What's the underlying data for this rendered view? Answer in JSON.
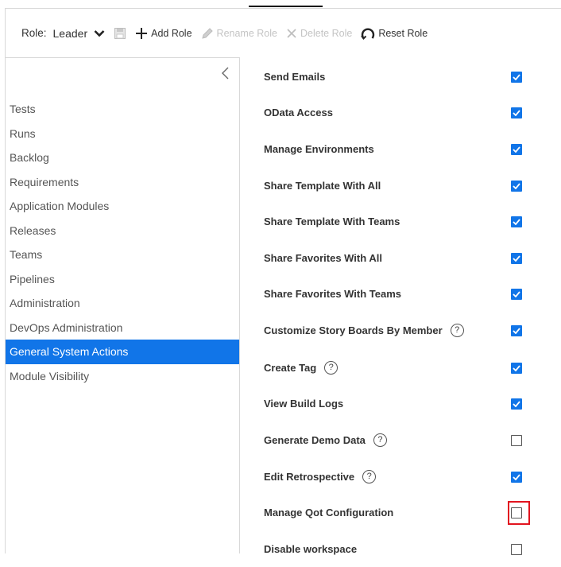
{
  "toolbar": {
    "role_label": "Role:",
    "role_value": "Leader",
    "add_role": "Add Role",
    "rename_role": "Rename Role",
    "delete_role": "Delete Role",
    "reset_role": "Reset Role"
  },
  "sidebar": {
    "items": [
      {
        "label": "Tests"
      },
      {
        "label": "Runs"
      },
      {
        "label": "Backlog"
      },
      {
        "label": "Requirements"
      },
      {
        "label": "Application Modules"
      },
      {
        "label": "Releases"
      },
      {
        "label": "Teams"
      },
      {
        "label": "Pipelines"
      },
      {
        "label": "Administration"
      },
      {
        "label": "DevOps Administration"
      },
      {
        "label": "General System Actions"
      },
      {
        "label": "Module Visibility"
      }
    ],
    "active_item": "General System Actions"
  },
  "permissions": [
    {
      "label": "Send Emails",
      "checked": true,
      "help": false
    },
    {
      "label": "OData Access",
      "checked": true,
      "help": false
    },
    {
      "label": "Manage Environments",
      "checked": true,
      "help": false
    },
    {
      "label": "Share Template With All",
      "checked": true,
      "help": false
    },
    {
      "label": "Share Template With Teams",
      "checked": true,
      "help": false
    },
    {
      "label": "Share Favorites With All",
      "checked": true,
      "help": false
    },
    {
      "label": "Share Favorites With Teams",
      "checked": true,
      "help": false
    },
    {
      "label": "Customize Story Boards By Member",
      "checked": true,
      "help": true
    },
    {
      "label": "Create Tag",
      "checked": true,
      "help": true
    },
    {
      "label": "View Build Logs",
      "checked": true,
      "help": false
    },
    {
      "label": "Generate Demo Data",
      "checked": false,
      "help": true
    },
    {
      "label": "Edit Retrospective",
      "checked": true,
      "help": true
    },
    {
      "label": "Manage Qot Configuration",
      "checked": false,
      "help": false,
      "highlighted": true
    },
    {
      "label": "Disable workspace",
      "checked": false,
      "help": false
    }
  ],
  "help_glyph": "?",
  "colors": {
    "accent": "#1175e8",
    "highlight": "#e2141f"
  }
}
